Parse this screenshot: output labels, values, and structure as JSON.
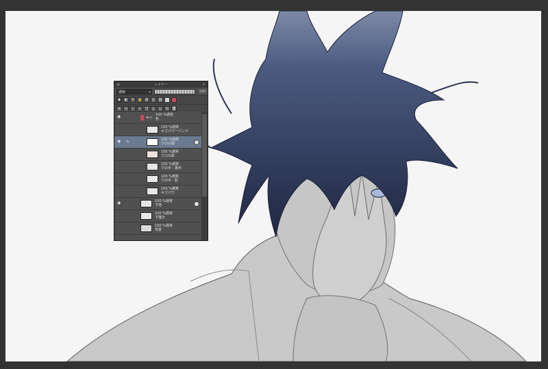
{
  "layer_panel": {
    "title": "レイヤー",
    "blend_mode": "通常",
    "opacity": "100",
    "icons": {
      "close": "close-icon",
      "menu": "menu-icon",
      "lock": "lock-icon",
      "new_layer": "new-layer-icon",
      "trash": "trash-icon",
      "eye": "eye-icon"
    },
    "layers": [
      {
        "line1": "100 %通常",
        "line2": "色"
      },
      {
        "line1": "100 %通常",
        "line2": "キズパワーパンド"
      },
      {
        "line1": "100 %通常",
        "line2": "クロの服"
      },
      {
        "line1": "100 %通常",
        "line2": "クロの肌"
      },
      {
        "line1": "100 %通常",
        "line2": "クの手：裏手"
      },
      {
        "line1": "100 %通常",
        "line2": "クの手：肌"
      },
      {
        "line1": "100 %乗算",
        "line2": "キズパワ"
      },
      {
        "line1": "100 %通常",
        "line2": "下地"
      },
      {
        "line1": "100 %通常",
        "line2": "下描き"
      },
      {
        "line1": "100 %通常",
        "line2": "背景"
      }
    ]
  },
  "colors": {
    "app_bg": "#333334",
    "canvas_bg": "#f5f5f5",
    "hair": "#2a3350",
    "skin_fill": "#c9c9c9",
    "selected_layer": "#6a7a90"
  }
}
